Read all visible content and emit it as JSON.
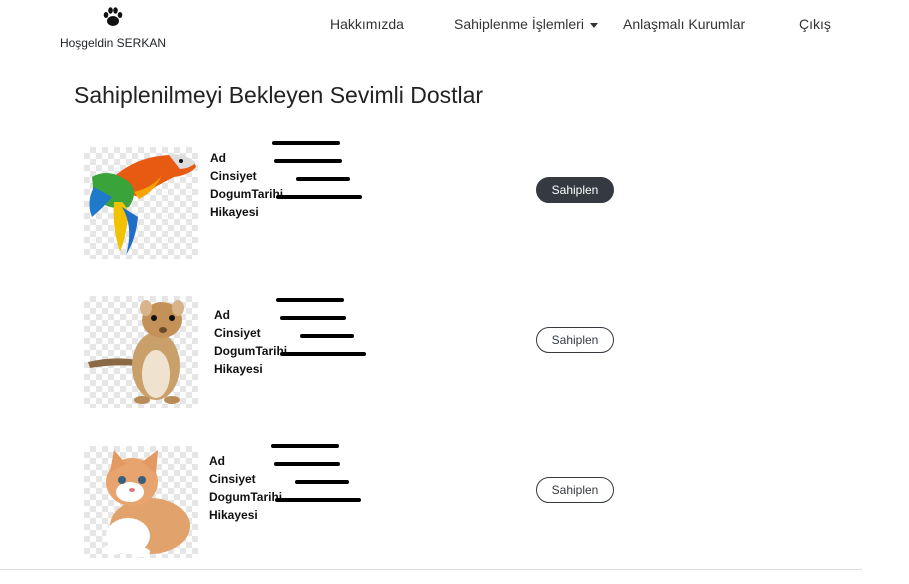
{
  "brand": {
    "icon": "paw-icon",
    "greeting": "Hoşgeldin SERKAN"
  },
  "nav": {
    "about": "Hakkımızda",
    "adoption": "Sahiplenme İşlemleri",
    "partners": "Anlaşmalı Kurumlar",
    "logout": "Çıkış"
  },
  "page": {
    "title": "Sahiplenilmeyi Bekleyen Sevimli Dostlar"
  },
  "labels": {
    "name": "Ad",
    "gender": "Cinsiyet",
    "birthdate": "DogumTarihi",
    "story": "Hikayesi"
  },
  "pets": [
    {
      "image": "parrot-image",
      "adopt_label": "Sahiplen",
      "button_style": "dark"
    },
    {
      "image": "gerbil-image",
      "adopt_label": "Sahiplen",
      "button_style": "outline"
    },
    {
      "image": "kitten-image",
      "adopt_label": "Sahiplen",
      "button_style": "outline"
    }
  ],
  "colors": {
    "button_dark": "#343a40",
    "text": "#212529"
  }
}
